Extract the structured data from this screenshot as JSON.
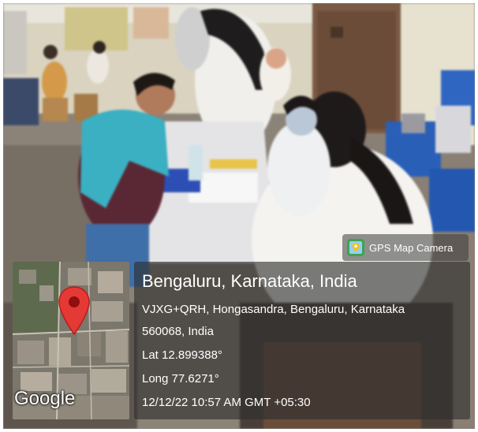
{
  "overlay": {
    "brand": {
      "label": "GPS Map Camera"
    },
    "map": {
      "logo_text": "Google"
    },
    "location": {
      "title": "Bengaluru, Karnataka, India",
      "address_line1": "VJXG+QRH, Hongasandra, Bengaluru, Karnataka",
      "address_line2": "560068, India",
      "latitude": "Lat 12.899388°",
      "longitude": "Long 77.6271°",
      "timestamp": "12/12/22 10:57 AM GMT +05:30"
    }
  },
  "colors": {
    "panel_bg": "#2d2d2d",
    "map_pin": "#e53935",
    "text": "#ffffff"
  }
}
